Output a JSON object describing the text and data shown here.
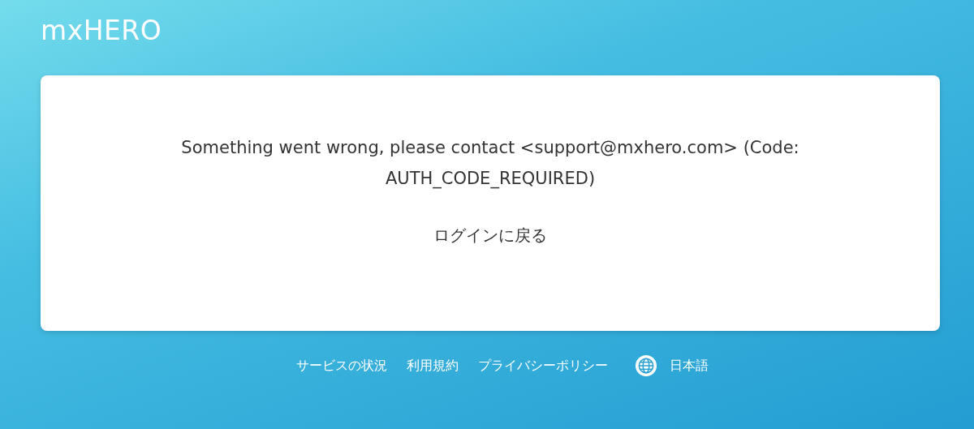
{
  "logo": "mxHERO",
  "card": {
    "message": "Something went wrong, please contact <support@mxhero.com> (Code: AUTH_CODE_REQUIRED)",
    "back_link": "ログインに戻る"
  },
  "footer": {
    "links": [
      "サービスの状況",
      "利用規約",
      "プライバシーポリシー"
    ],
    "language": "日本語"
  }
}
